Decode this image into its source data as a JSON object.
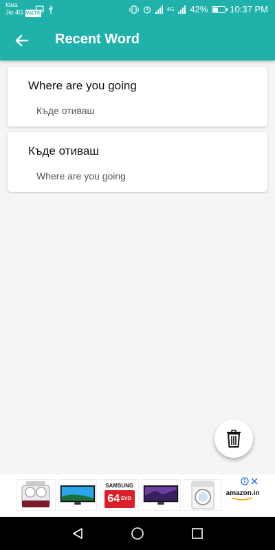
{
  "status_bar": {
    "carrier_line1": "Idea",
    "carrier_line2": "Jio 4G",
    "lte_badge": "VoLTE",
    "network": "4G",
    "battery": "42%",
    "battery_level": 0.42,
    "time": "10:37 PM"
  },
  "app_bar": {
    "title": "Recent Word",
    "back_icon": "arrow-left-icon"
  },
  "words": [
    {
      "source": "Where are you going",
      "translation": "Къде отиваш"
    },
    {
      "source": "Къде отиваш",
      "translation": "Where are you going"
    }
  ],
  "fab": {
    "icon": "trash-icon"
  },
  "ad": {
    "sd_brand": "SAMSUNG",
    "sd_size": "64",
    "sd_label": "EVO",
    "amazon": "amazon.in",
    "info_icon": "info-icon",
    "close_icon": "close-icon"
  },
  "nav": {
    "back_icon": "nav-back-icon",
    "home_icon": "nav-home-icon",
    "recents_icon": "nav-recents-icon"
  },
  "colors": {
    "primary": "#20b2aa",
    "background": "#f5f5f5"
  }
}
